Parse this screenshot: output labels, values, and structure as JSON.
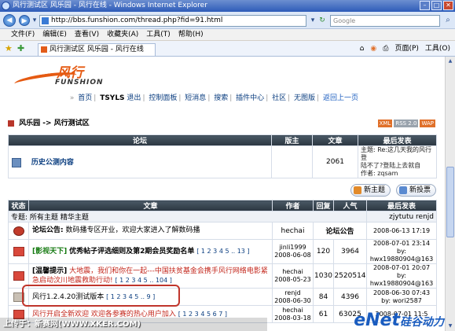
{
  "window": {
    "title": "风行测试区 风乐园 - 风行在线 - Windows Internet Explorer"
  },
  "address": {
    "url": "http://bbs.funshion.com/thread.php?fid=91.html",
    "search_placeholder": "Google"
  },
  "menu": [
    "文件(F)",
    "编辑(E)",
    "查看(V)",
    "收藏夹(A)",
    "工具(T)",
    "帮助(H)"
  ],
  "tab": {
    "title": "风行测试区 风乐园 - 风行在线"
  },
  "toolbar": {
    "page_label": "页面(P)",
    "tools_label": "工具(O)"
  },
  "site": {
    "logo_cn": "风行",
    "logo_en": "FUNSHION",
    "nav": [
      "首页",
      "TSYLS",
      "退出",
      "控制面板",
      "短消息",
      "搜索",
      "插件中心",
      "社区",
      "无图版"
    ],
    "back_link": "返回上一页"
  },
  "breadcrumb": "风乐园 -> 风行测试区",
  "badges": [
    {
      "label": "XML",
      "color": "#e0702a"
    },
    {
      "label": "RSS 2.0",
      "color": "#9aa3ad"
    },
    {
      "label": "WAP",
      "color": "#e0702a"
    }
  ],
  "forum_table": {
    "headers": [
      "论坛",
      "版主",
      "文章",
      "最后发表"
    ],
    "row": {
      "name": "历史公测内容",
      "posts": "2061",
      "last_line1": "主题: Re:这几天我的风行登",
      "last_line2": "陆不了?登陆上去就自",
      "last_line3": "作者: zqsam"
    }
  },
  "actions": {
    "new_topic": "新主题",
    "new_poll": "新投票"
  },
  "thread_table": {
    "headers": [
      "状态",
      "文章",
      "作者",
      "回复",
      "人气",
      "最后发表"
    ],
    "filter": {
      "label": "专题:",
      "all": "所有主题",
      "best": "精华主题",
      "moderators": "zjytutu renjd"
    },
    "rows": [
      {
        "icon": "announcement",
        "title_prefix": "论坛公告:",
        "title": "数码播专区开业，欢迎大家进入了解数码播",
        "author": "hechai",
        "replies": "论坛公告",
        "views": "",
        "last": "2008-06-13 17:19",
        "last_by": ""
      },
      {
        "icon": "hot",
        "title_prefix": "[影视天下]",
        "title": "优秀帖子评选细则及第2期会员奖励名单",
        "pages": "[ 1 2 3 4 5 .. 13 ]",
        "author": "jinli1999",
        "author_date": "2008-06-08",
        "replies": "120",
        "views": "3964",
        "last": "2008-07-01 23:14",
        "last_by": "by: hwx19880904@163"
      },
      {
        "icon": "hot",
        "title_prefix": "[温馨提示]",
        "title": "大地震，我们和你在一起---中国扶贫基金会携手风行网络电影紧急启动汶川地震救助行动!",
        "pages": "[ 1 2 3 4 5 .. 104 ]",
        "author": "hechai",
        "author_date": "2008-05-23",
        "replies": "1030",
        "views": "2520514",
        "last": "2008-07-01 20:07",
        "last_by": "by: hwx19880904@163"
      },
      {
        "icon": "normal",
        "title_prefix": "",
        "title": "风行1.2.4.20测试版本",
        "pages": "[ 1 2 3 4 5 .. 9 ]",
        "author": "renjd",
        "author_date": "2008-06-30",
        "replies": "84",
        "views": "4396",
        "last": "2008-06-30 07:43",
        "last_by": "by: wori2587"
      },
      {
        "icon": "hot",
        "title_prefix": "",
        "title": "风行开启全新欢迎 欢迎各参赛的热心用户加入",
        "pages": "[ 1 2 3 4 5 6 7 ]",
        "author": "hechai",
        "author_date": "2008-03-18",
        "replies": "61",
        "views": "63025",
        "last": "2008-07-01 11:5",
        "last_by": ""
      }
    ]
  },
  "watermark": "上传于：新赛网(WWW.XKER.COM)",
  "corner_logo": {
    "main": "eNet",
    "sub": "硅谷动力"
  }
}
